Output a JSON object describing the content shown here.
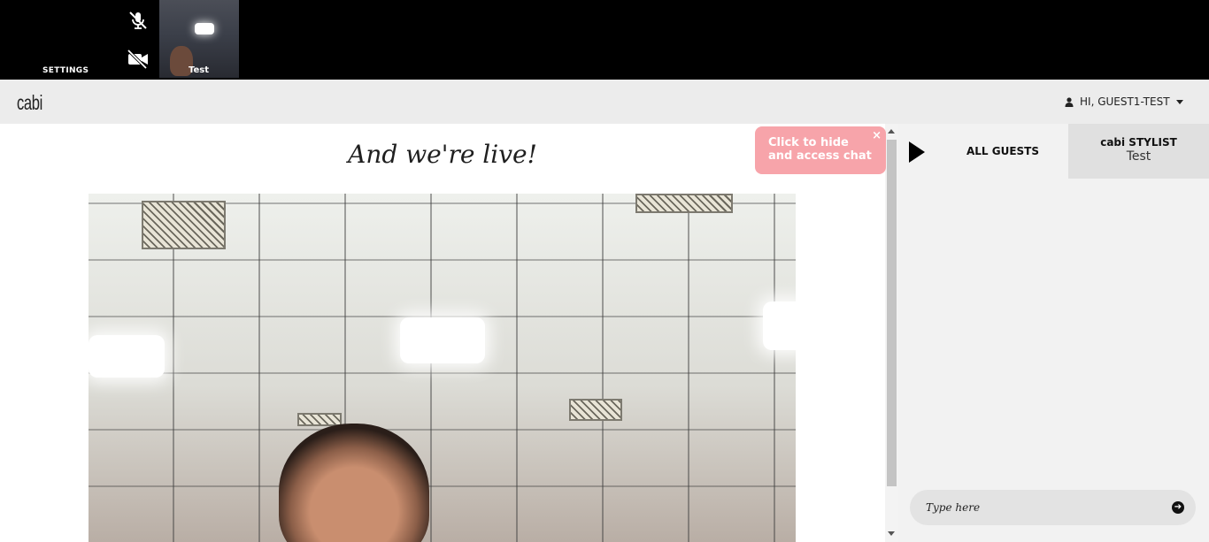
{
  "topbar": {
    "settings_label": "SETTINGS",
    "mic_icon": "mic-off-icon",
    "camera_icon": "camera-off-icon",
    "self_view_label": "Test"
  },
  "header": {
    "logo_text": "cabi",
    "user_greeting": "HI, GUEST1-TEST"
  },
  "main": {
    "title": "And we're live!"
  },
  "tooltip": {
    "line1": "Click to hide",
    "line2": "and access chat",
    "close_symbol": "×"
  },
  "chat": {
    "tab_all": "ALL GUESTS",
    "tab_stylist_title": "cabi STYLIST",
    "tab_stylist_name": "Test",
    "input_placeholder": "Type here"
  },
  "colors": {
    "topbar": "#000000",
    "header": "#ececec",
    "tooltip": "#f7a4aa",
    "chat_panel": "#f2f2f2"
  }
}
